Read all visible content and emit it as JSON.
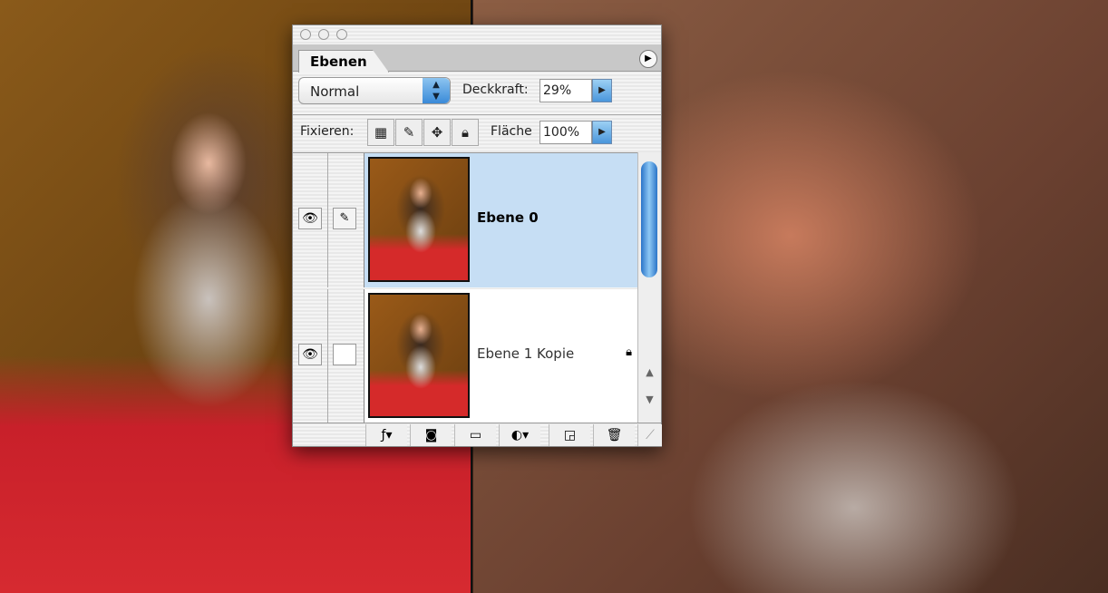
{
  "panel": {
    "tab_label": "Ebenen",
    "blend_mode": "Normal",
    "opacity_label": "Deckkraft:",
    "opacity_value": "29%",
    "lock_label": "Fixieren:",
    "fill_label": "Fläche",
    "fill_value": "100%",
    "layers": [
      {
        "name": "Ebene 0",
        "selected": true,
        "visible": true,
        "locked": false
      },
      {
        "name": "Ebene 1 Kopie",
        "selected": false,
        "visible": true,
        "locked": true
      }
    ]
  },
  "colors": {
    "selection": "#c6def4",
    "accent": "#3a8ad8"
  }
}
